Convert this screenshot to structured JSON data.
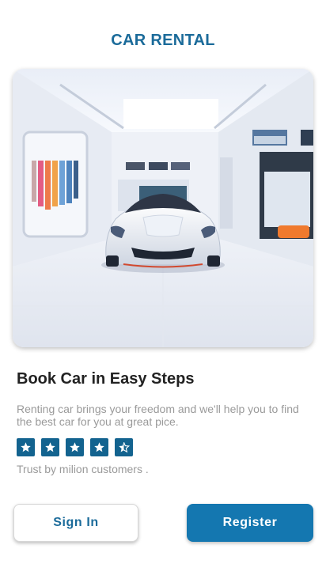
{
  "header": {
    "title": "CAR RENTAL"
  },
  "hero": {
    "image": "car-showroom-photo"
  },
  "content": {
    "headline": "Book Car in Easy Steps",
    "description": "Renting car brings your freedom and we'll help you to find the best car for you at great pice.",
    "rating": 4.5,
    "rating_max": 5,
    "trust_text": "Trust by milion customers ."
  },
  "actions": {
    "sign_in_label": "Sign In",
    "register_label": "Register"
  },
  "colors": {
    "brand": "#1b6b9a",
    "primary_button": "#1477b0",
    "star_box": "#13638f",
    "muted_text": "#9a9a9a"
  }
}
